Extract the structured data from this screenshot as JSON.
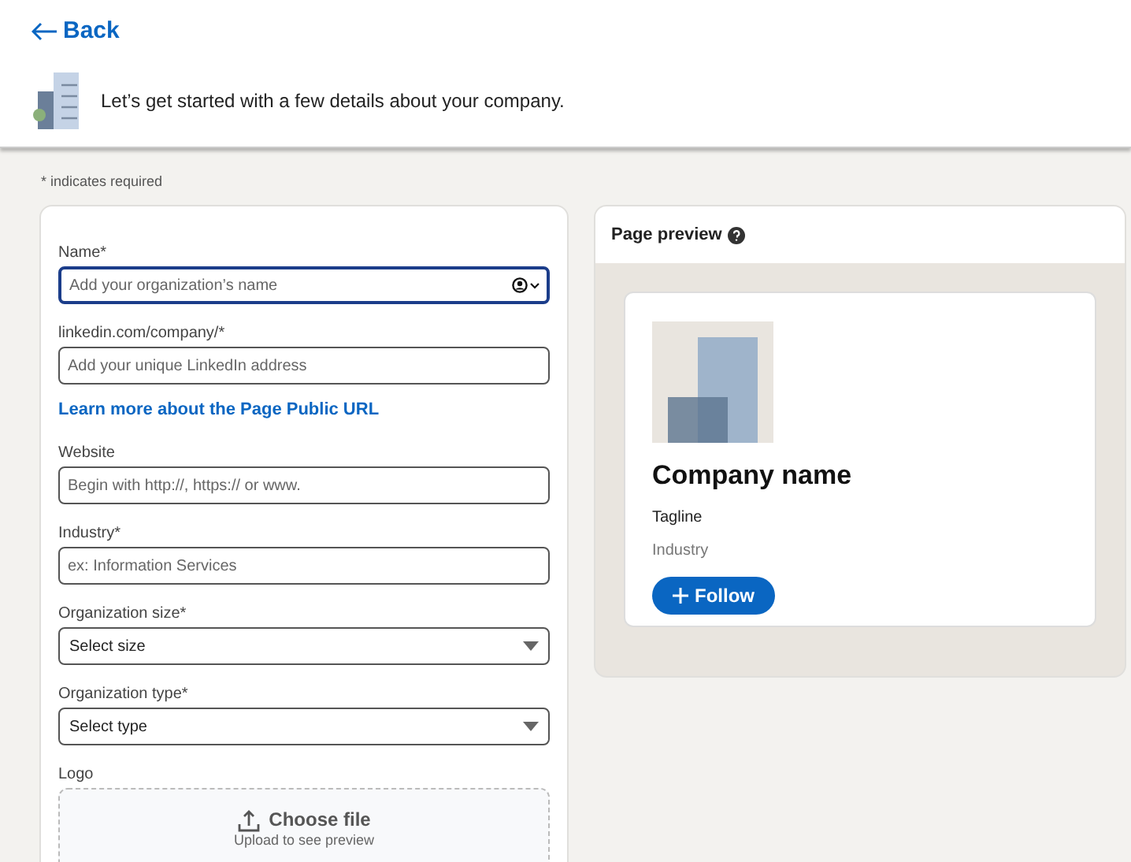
{
  "back": {
    "label": "Back"
  },
  "intro": {
    "text": "Let’s get started with a few details about your company."
  },
  "required_note": "* indicates required",
  "form": {
    "fields": [
      {
        "kind": "text",
        "label": "Name*",
        "placeholder": "Add your organization’s name",
        "focused": true,
        "account_picker": true
      },
      {
        "kind": "text",
        "label": "linkedin.com/company/*",
        "placeholder": "Add your unique LinkedIn address",
        "focused": false
      },
      {
        "kind": "link",
        "label": "Learn more about the Page Public URL"
      },
      {
        "kind": "text",
        "label": "Website",
        "placeholder": "Begin with http://, https:// or www.",
        "focused": false
      },
      {
        "kind": "text",
        "label": "Industry*",
        "placeholder": "ex: Information Services",
        "focused": false
      },
      {
        "kind": "select",
        "label": "Organization size*",
        "value": "Select size"
      },
      {
        "kind": "select",
        "label": "Organization type*",
        "value": "Select type"
      },
      {
        "kind": "upload",
        "label": "Logo",
        "button": "Choose file",
        "hint": "Upload to see preview"
      }
    ]
  },
  "preview": {
    "title": "Page preview",
    "company_name": "Company name",
    "tagline": "Tagline",
    "industry": "Industry",
    "follow": "Follow"
  }
}
